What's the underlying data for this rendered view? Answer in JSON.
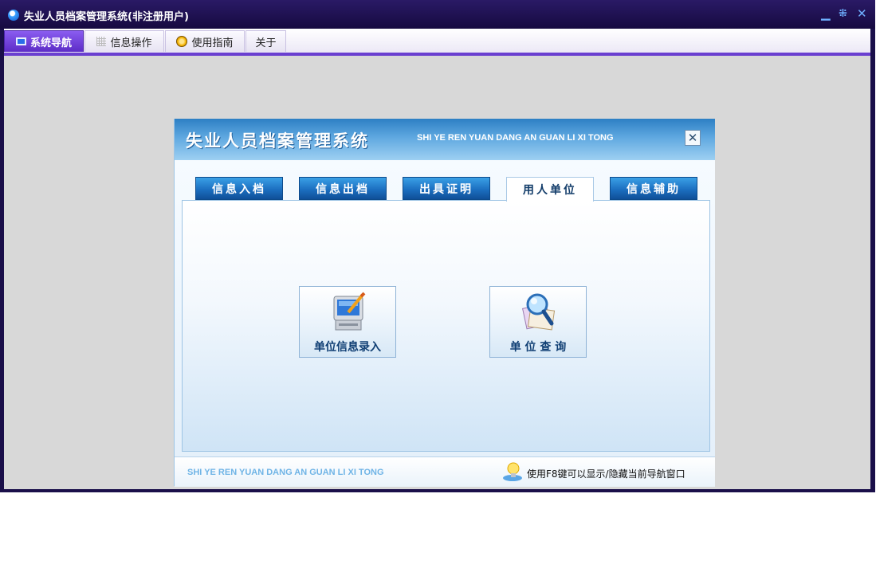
{
  "window": {
    "title": "失业人员档案管理系统(非注册用户)"
  },
  "menubar": {
    "tabs": [
      {
        "label": "系统导航",
        "icon": "monitor-icon",
        "active": true
      },
      {
        "label": "信息操作",
        "icon": "grid-icon",
        "active": false
      },
      {
        "label": "使用指南",
        "icon": "guide-icon",
        "active": false
      },
      {
        "label": "关于",
        "icon": "",
        "active": false
      }
    ]
  },
  "panel": {
    "title": "失业人员档案管理系统",
    "subtitle": "SHI YE REN YUAN DANG AN GUAN LI XI TONG",
    "close_label": "✕",
    "tabs": [
      {
        "label": "信息入档",
        "active": false
      },
      {
        "label": "信息出档",
        "active": false
      },
      {
        "label": "出具证明",
        "active": false
      },
      {
        "label": "用人单位",
        "active": true
      },
      {
        "label": "信息辅助",
        "active": false
      }
    ],
    "functions": [
      {
        "label": "单位信息录入",
        "icon": "computer-edit-icon"
      },
      {
        "label": "单 位 查 询",
        "icon": "magnifier-search-icon"
      }
    ],
    "footer": {
      "left_text": "SHI YE REN YUAN DANG AN GUAN LI XI TONG",
      "hint_text": "使用F8键可以显示/隐藏当前导航窗口",
      "hint_icon": "lightbulb-icon"
    }
  },
  "colors": {
    "titlebar": "#1a0f4a",
    "accent": "#6a3fd0",
    "panel_blue": "#1c6fc0"
  }
}
